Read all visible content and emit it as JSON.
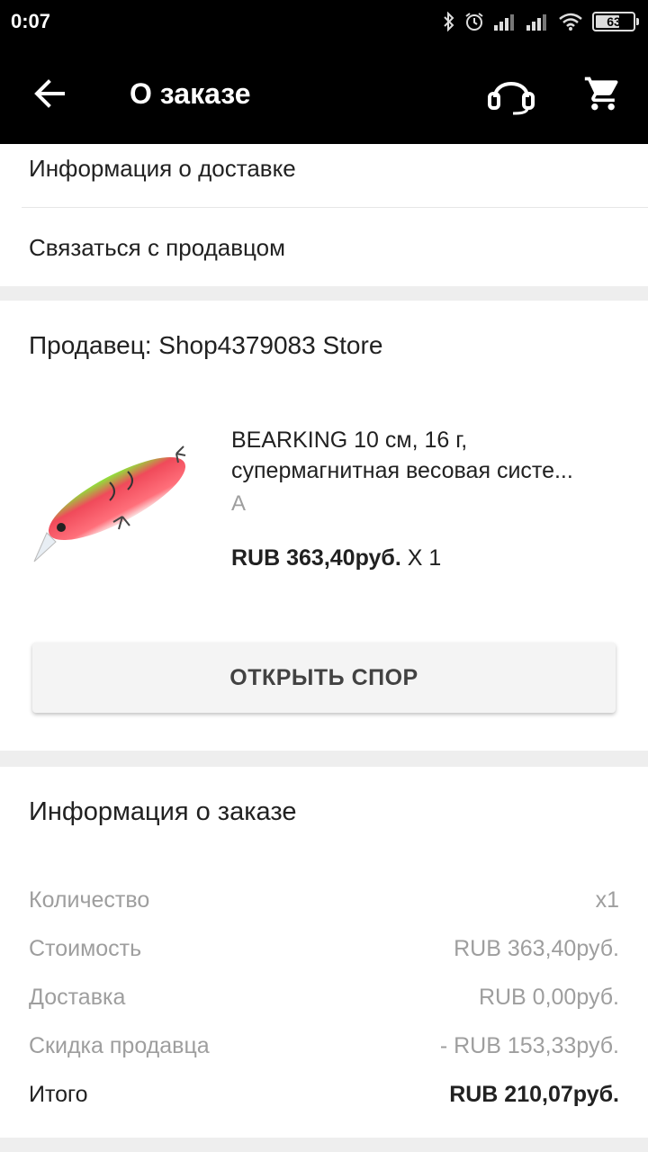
{
  "status_bar": {
    "time": "0:07",
    "battery": "63"
  },
  "toolbar": {
    "title": "О заказе",
    "back_icon": "arrow-left-icon",
    "support_icon": "headset-icon",
    "cart_icon": "cart-icon"
  },
  "links": {
    "delivery_info": "Информация о доставке",
    "contact_seller": "Связаться с продавцом"
  },
  "seller": {
    "label": "Продавец: Shop4379083 Store"
  },
  "product": {
    "name_line1": "BEARKING 10 см, 16 г,",
    "name_line2": "супермагнитная весовая систе...",
    "variant": "A",
    "price": "RUB 363,40руб.",
    "quantity": " X 1"
  },
  "dispute_button": "ОТКРЫТЬ СПОР",
  "order_info": {
    "title": "Информация о заказе",
    "rows": [
      {
        "label": "Количество",
        "value": "x1"
      },
      {
        "label": "Стоимость",
        "value": "RUB 363,40руб."
      },
      {
        "label": "Доставка",
        "value": "RUB 0,00руб."
      },
      {
        "label": "Скидка продавца",
        "value": "- RUB 153,33руб."
      }
    ],
    "total": {
      "label": "Итого",
      "value": "RUB 210,07руб."
    }
  },
  "colors": {
    "toolbar_bg": "#000000",
    "card_bg": "#ffffff",
    "page_bg": "#eeeeee",
    "muted_text": "#9e9e9e"
  }
}
